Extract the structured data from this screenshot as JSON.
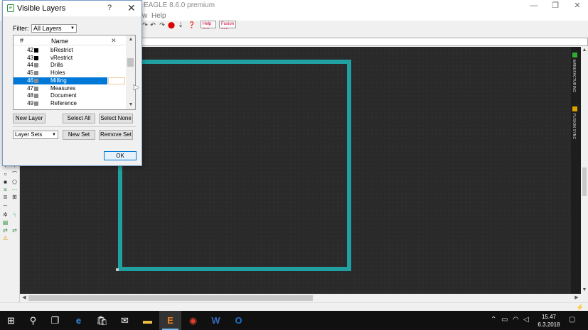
{
  "app": {
    "title": "EAGLE 8.6.0 premium",
    "menu": {
      "view_fragment": "w",
      "help": "Help"
    },
    "window_controls": {
      "minimize": "—",
      "restore": "❐",
      "close": "✕"
    },
    "toolbar": {
      "btn1": "Help Tab",
      "btn2": "Fusion 360"
    },
    "right_panel": {
      "label1": "MANUFACTURING",
      "label2": "FUSION SYNC"
    }
  },
  "dialog": {
    "title": "Visible Layers",
    "help_glyph": "?",
    "close_glyph": "✕",
    "filter": {
      "label": "Filter:",
      "value": "All Layers"
    },
    "list": {
      "headers": {
        "num": "#",
        "name": "Name",
        "x": "✕"
      },
      "rows": [
        {
          "num": "42",
          "name": "bRestrict",
          "color": "#000000"
        },
        {
          "num": "43",
          "name": "vRestrict",
          "color": "#000000"
        },
        {
          "num": "44",
          "name": "Drills",
          "color": "#8a8a8a"
        },
        {
          "num": "45",
          "name": "Holes",
          "color": "#8a8a8a"
        },
        {
          "num": "46",
          "name": "Milling",
          "color": "#8a8a8a",
          "selected": true
        },
        {
          "num": "47",
          "name": "Measures",
          "color": "#8a8a8a"
        },
        {
          "num": "48",
          "name": "Document",
          "color": "#8a8a8a"
        },
        {
          "num": "49",
          "name": "Reference",
          "color": "#8a8a8a"
        }
      ]
    },
    "buttons": {
      "new_layer": "New Layer",
      "select_all": "Select All",
      "select_none": "Select None",
      "new_set": "New Set",
      "remove_set": "Remove Set",
      "ok": "OK"
    },
    "layer_sets": {
      "value": "Layer Sets"
    }
  },
  "taskbar": {
    "clock": {
      "time": "15.47",
      "date": "6.3.2018"
    }
  },
  "colors": {
    "board_outline": "#20a0a0",
    "selection": "#0078d7",
    "canvas": "#2a2a2a"
  }
}
